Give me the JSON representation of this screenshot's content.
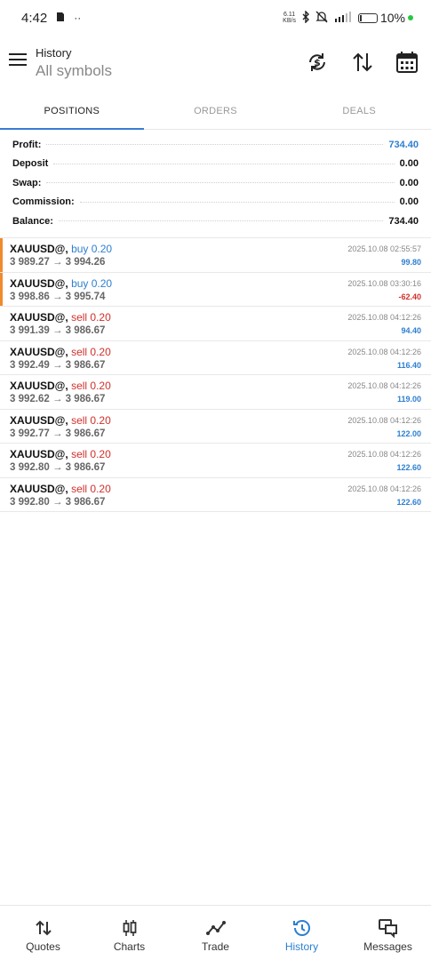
{
  "status_bar": {
    "time": "4:42",
    "net_speed_top": "6.11",
    "net_speed_bottom": "KB/s",
    "battery": "10%",
    "icons": [
      "sim-icon",
      "more-dots-icon",
      "bluetooth-icon",
      "mute-icon",
      "signal-icon",
      "battery-icon"
    ]
  },
  "header": {
    "title": "History",
    "subtitle": "All symbols",
    "icons": [
      "currency-refresh-icon",
      "sort-icon",
      "calendar-icon"
    ]
  },
  "tabs": [
    {
      "label": "POSITIONS",
      "active": true
    },
    {
      "label": "ORDERS",
      "active": false
    },
    {
      "label": "DEALS",
      "active": false
    }
  ],
  "summary": [
    {
      "label": "Profit:",
      "value": "734.40",
      "highlight": true
    },
    {
      "label": "Deposit",
      "value": "0.00",
      "highlight": false
    },
    {
      "label": "Swap:",
      "value": "0.00",
      "highlight": false
    },
    {
      "label": "Commission:",
      "value": "0.00",
      "highlight": false
    },
    {
      "label": "Balance:",
      "value": "734.40",
      "highlight": false
    }
  ],
  "deals": [
    {
      "symbol": "XAUUSD@,",
      "side": "buy 0.20",
      "type": "buy",
      "prices": "3 989.27 → 3 994.26",
      "time": "2025.10.08 02:55:57",
      "pnl": "99.80",
      "pnl_sign": "pos",
      "marked": true
    },
    {
      "symbol": "XAUUSD@,",
      "side": "buy 0.20",
      "type": "buy",
      "prices": "3 998.86 → 3 995.74",
      "time": "2025.10.08 03:30:16",
      "pnl": "-62.40",
      "pnl_sign": "neg",
      "marked": true
    },
    {
      "symbol": "XAUUSD@,",
      "side": "sell 0.20",
      "type": "sell",
      "prices": "3 991.39 → 3 986.67",
      "time": "2025.10.08 04:12:26",
      "pnl": "94.40",
      "pnl_sign": "pos",
      "marked": false
    },
    {
      "symbol": "XAUUSD@,",
      "side": "sell 0.20",
      "type": "sell",
      "prices": "3 992.49 → 3 986.67",
      "time": "2025.10.08 04:12:26",
      "pnl": "116.40",
      "pnl_sign": "pos",
      "marked": false
    },
    {
      "symbol": "XAUUSD@,",
      "side": "sell 0.20",
      "type": "sell",
      "prices": "3 992.62 → 3 986.67",
      "time": "2025.10.08 04:12:26",
      "pnl": "119.00",
      "pnl_sign": "pos",
      "marked": false
    },
    {
      "symbol": "XAUUSD@,",
      "side": "sell 0.20",
      "type": "sell",
      "prices": "3 992.77 → 3 986.67",
      "time": "2025.10.08 04:12:26",
      "pnl": "122.00",
      "pnl_sign": "pos",
      "marked": false
    },
    {
      "symbol": "XAUUSD@,",
      "side": "sell 0.20",
      "type": "sell",
      "prices": "3 992.80 → 3 986.67",
      "time": "2025.10.08 04:12:26",
      "pnl": "122.60",
      "pnl_sign": "pos",
      "marked": false
    },
    {
      "symbol": "XAUUSD@,",
      "side": "sell 0.20",
      "type": "sell",
      "prices": "3 992.80 → 3 986.67",
      "time": "2025.10.08 04:12:26",
      "pnl": "122.60",
      "pnl_sign": "pos",
      "marked": false
    }
  ],
  "bottom_nav": [
    {
      "label": "Quotes",
      "icon": "quotes-arrows-icon",
      "active": false
    },
    {
      "label": "Charts",
      "icon": "candlestick-icon",
      "active": false
    },
    {
      "label": "Trade",
      "icon": "trade-line-icon",
      "active": false
    },
    {
      "label": "History",
      "icon": "history-clock-icon",
      "active": true
    },
    {
      "label": "Messages",
      "icon": "messages-icon",
      "active": false
    }
  ],
  "colors": {
    "accent": "#2d7fd0",
    "loss": "#d0302a",
    "marker": "#f08a2c"
  }
}
